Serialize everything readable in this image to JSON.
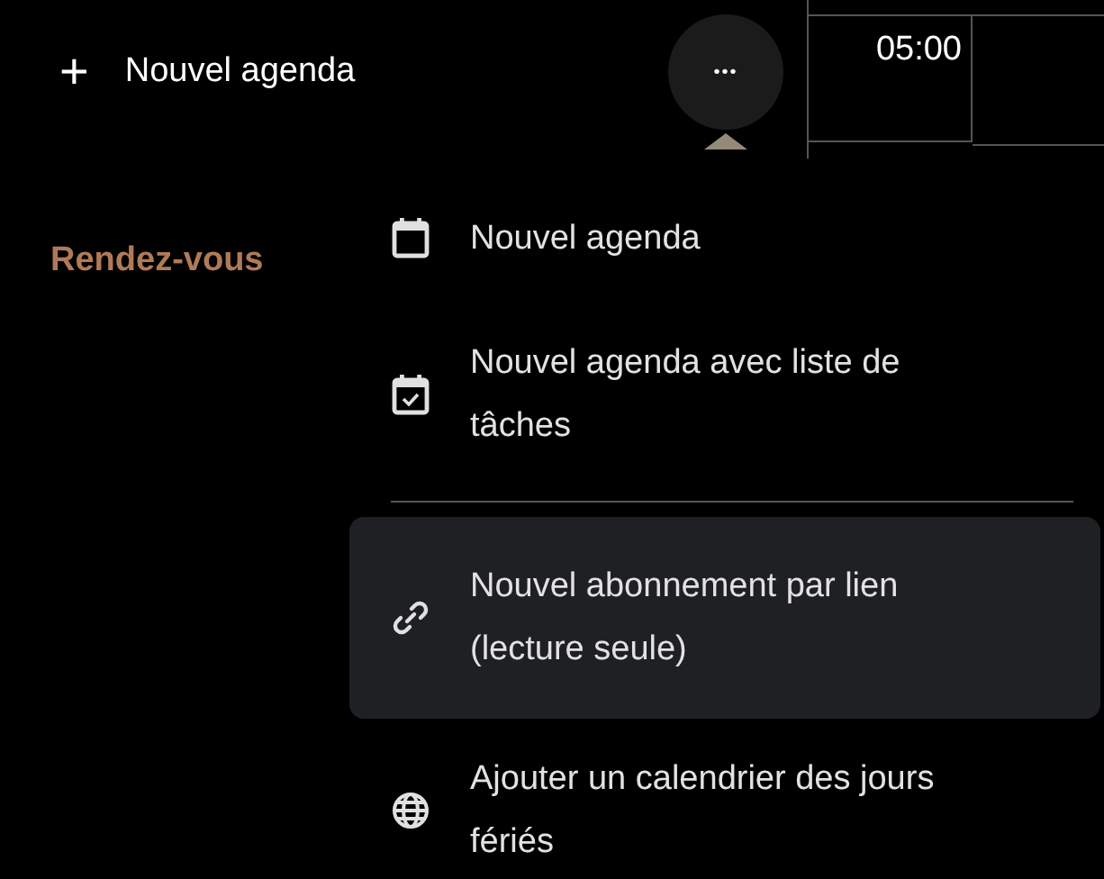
{
  "new_calendar_button": {
    "icon": "+",
    "label": "Nouvel agenda"
  },
  "more_button": {
    "label": "•••",
    "expanded": true
  },
  "time_grid": {
    "time": "05:00"
  },
  "section_title": "Rendez-vous",
  "menu": {
    "items": [
      {
        "label": "Nouvel agenda",
        "selected": false
      },
      {
        "label": "Nouvel agenda avec liste de tâches",
        "selected": false
      },
      {
        "label": "Nouvel abonnement par lien (lecture seule)",
        "selected": true
      },
      {
        "label": "Ajouter un calendrier des jours fériés",
        "selected": false
      }
    ]
  }
}
